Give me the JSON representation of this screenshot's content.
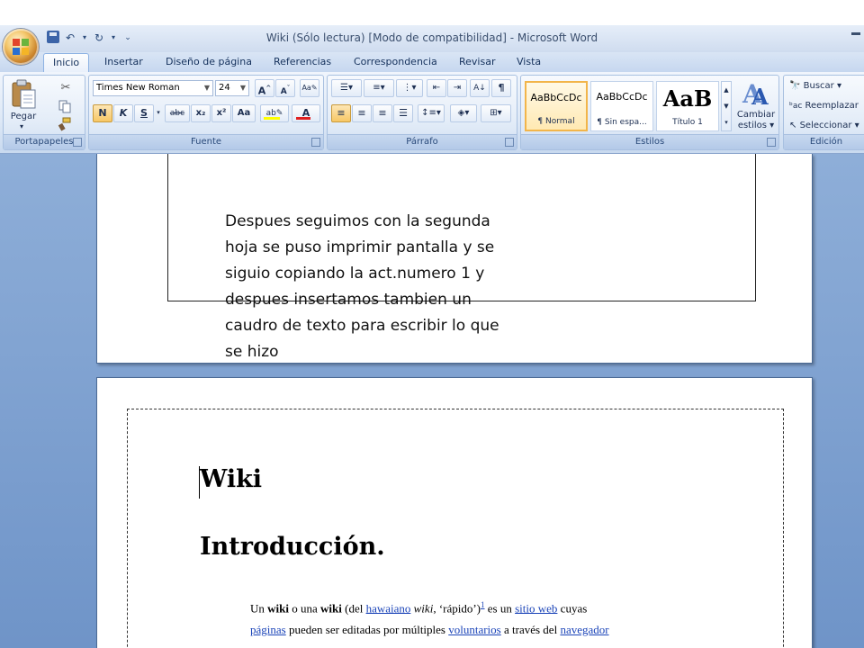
{
  "window": {
    "title": "Wiki (Sólo lectura) [Modo de compatibilidad] - Microsoft Word"
  },
  "tabs": [
    "Inicio",
    "Insertar",
    "Diseño de página",
    "Referencias",
    "Correspondencia",
    "Revisar",
    "Vista"
  ],
  "active_tab": "Inicio",
  "ribbon": {
    "portapapeles": {
      "label": "Portapapeles",
      "paste_label": "Pegar"
    },
    "fuente": {
      "label": "Fuente",
      "font_name": "Times New Roman",
      "font_size": "24",
      "bold": "N",
      "italic": "K",
      "underline": "S",
      "strike": "abc",
      "subscript": "x₂",
      "superscript": "x²",
      "change_case": "Aa"
    },
    "parrafo": {
      "label": "Párrafo"
    },
    "estilos": {
      "label": "Estilos",
      "items": [
        {
          "sample": "AaBbCcDc",
          "name": "¶ Normal"
        },
        {
          "sample": "AaBbCcDc",
          "name": "¶ Sin espa..."
        },
        {
          "sample": "AaB",
          "name": "Título 1"
        }
      ],
      "change_styles_line1": "Cambiar",
      "change_styles_line2": "estilos"
    },
    "edicion": {
      "label": "Edición",
      "find": "Buscar",
      "replace": "Reemplazar",
      "select": "Seleccionar"
    }
  },
  "document": {
    "page1_text_lines": [
      "Despues seguimos con la segunda",
      "hoja se puso imprimir pantalla y se",
      "siguio copiando la act.numero 1 y",
      "despues insertamos tambien un",
      "caudro de texto para escribir lo que",
      "se hizo"
    ],
    "page2": {
      "heading1": "Wiki",
      "heading2": "Introducción.",
      "para_line1": {
        "t1": "Un ",
        "b1": "wiki",
        "t2": " o una ",
        "b2": "wiki",
        "t3": " (del ",
        "l1": "hawaiano",
        "t4": " ",
        "i1": "wiki",
        "t5": ", ‘rápido’)",
        "sup": "1",
        "t6": " es un ",
        "l2": "sitio web",
        "t7": " cuyas"
      },
      "para_line2": {
        "l1": "páginas",
        "t1": " pueden ser editadas por múltiples ",
        "l2": "voluntarios",
        "t2": " a través del ",
        "l3": "navegador"
      }
    }
  },
  "colors": {
    "doc_background": "#7f9fd0",
    "link": "#1b44b8",
    "ribbon_accent": "#f2b54a"
  }
}
